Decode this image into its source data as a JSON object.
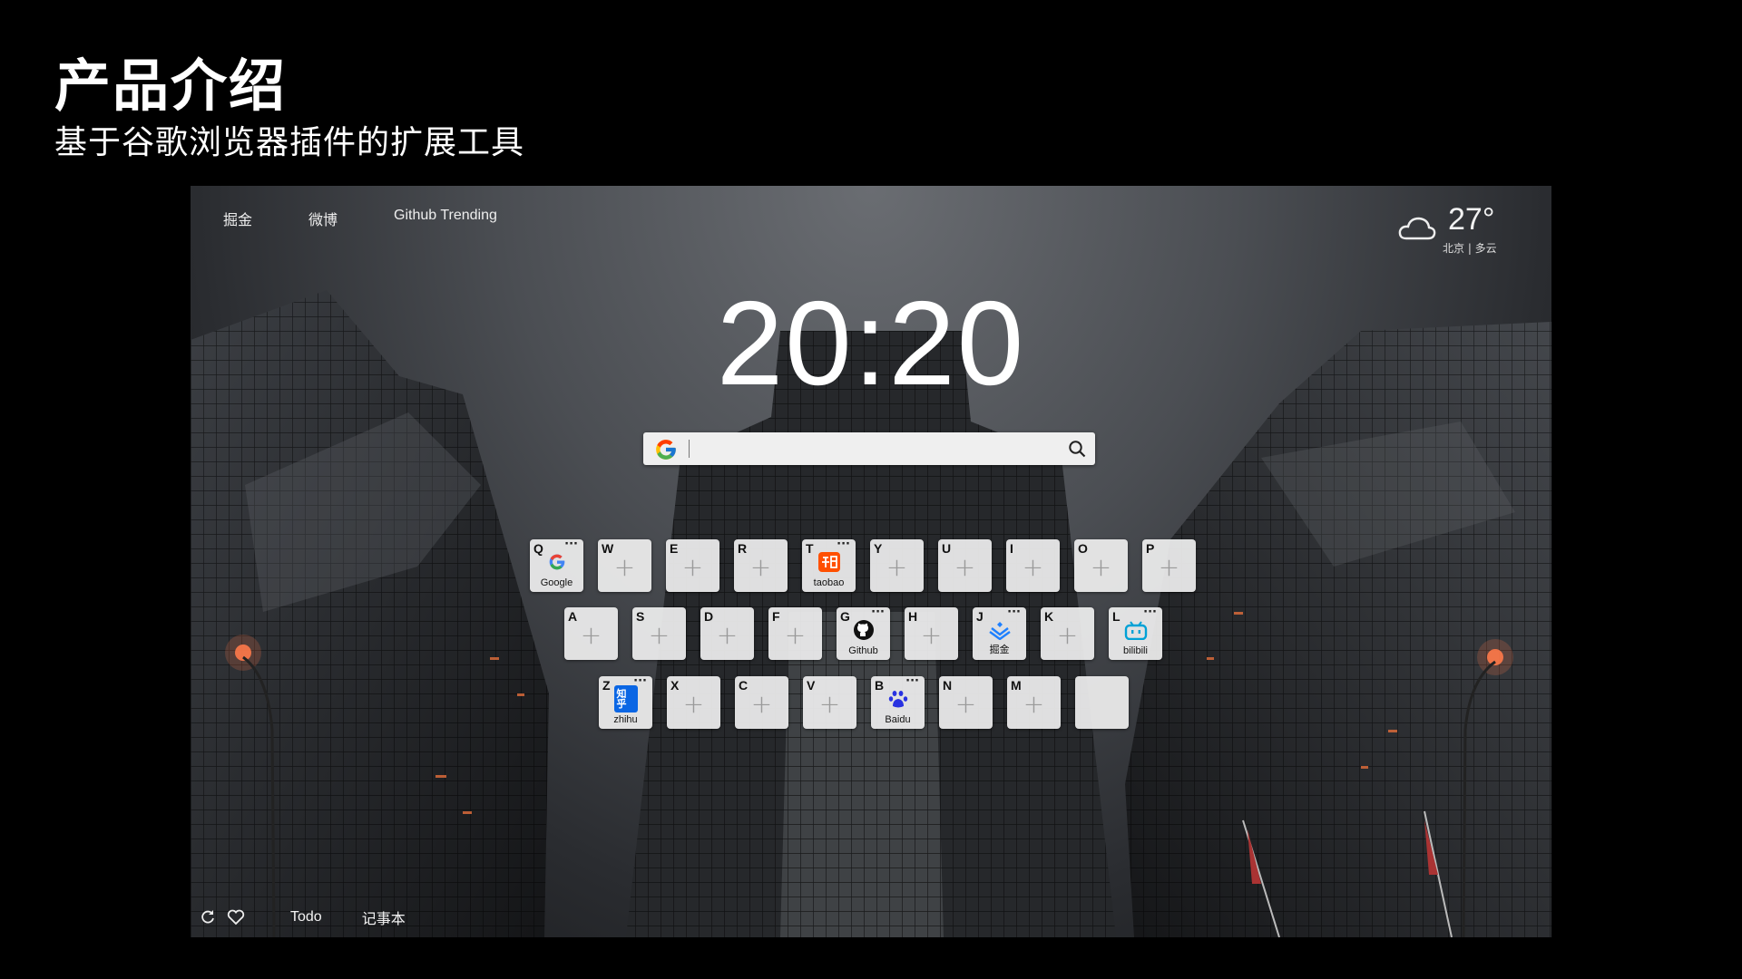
{
  "slide": {
    "title": "产品介绍",
    "subtitle": "基于谷歌浏览器插件的扩展工具"
  },
  "screen": {
    "nav": [
      "掘金",
      "微博",
      "Github Trending"
    ],
    "weather": {
      "temperature": "27°",
      "location": "北京 | 多云",
      "icon": "cloud-icon"
    },
    "clock": "20:20",
    "search": {
      "placeholder": "",
      "value": "",
      "engine_icon": "google-g-icon",
      "search_icon": "magnifier-icon"
    },
    "keys": {
      "row1": [
        {
          "letter": "Q",
          "site": "Google",
          "icon": "google-icon"
        },
        {
          "letter": "W"
        },
        {
          "letter": "E"
        },
        {
          "letter": "R"
        },
        {
          "letter": "T",
          "site": "taobao",
          "icon": "taobao-icon"
        },
        {
          "letter": "Y"
        },
        {
          "letter": "U"
        },
        {
          "letter": "I"
        },
        {
          "letter": "O"
        },
        {
          "letter": "P"
        }
      ],
      "row2": [
        {
          "letter": "A"
        },
        {
          "letter": "S"
        },
        {
          "letter": "D"
        },
        {
          "letter": "F"
        },
        {
          "letter": "G",
          "site": "Github",
          "icon": "github-icon"
        },
        {
          "letter": "H"
        },
        {
          "letter": "J",
          "site": "掘金",
          "icon": "juejin-icon"
        },
        {
          "letter": "K"
        },
        {
          "letter": "L",
          "site": "bilibili",
          "icon": "bilibili-icon"
        }
      ],
      "row3": [
        {
          "letter": "Z",
          "site": "zhihu",
          "icon": "zhihu-icon",
          "icon_text": "知乎"
        },
        {
          "letter": "X"
        },
        {
          "letter": "C"
        },
        {
          "letter": "V"
        },
        {
          "letter": "B",
          "site": "Baidu",
          "icon": "baidu-icon"
        },
        {
          "letter": "N"
        },
        {
          "letter": "M"
        },
        {
          "letter": ""
        }
      ]
    },
    "bottom": {
      "refresh_icon": "refresh-icon",
      "heart_icon": "heart-icon",
      "todo": "Todo",
      "notepad": "记事本"
    },
    "more_glyph": "···",
    "plus_glyph": "+",
    "colors": {
      "taobao": "#ff5000",
      "bilibili": "#00a1d6",
      "zhihu": "#0a66e4",
      "baidu": "#2932e1",
      "juejin": "#1e80ff"
    }
  }
}
